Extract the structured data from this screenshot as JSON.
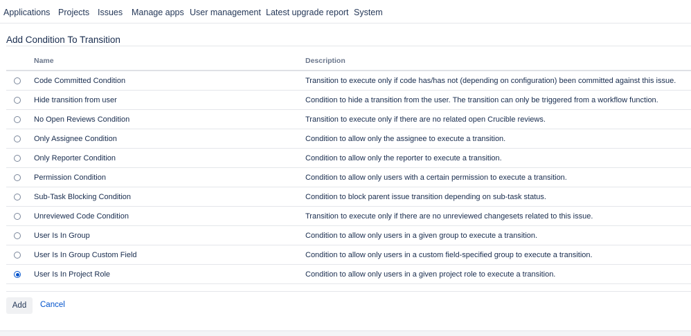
{
  "nav": {
    "items": [
      {
        "label": "Applications"
      },
      {
        "label": "Projects"
      },
      {
        "label": "Issues"
      },
      {
        "label": "Manage apps"
      },
      {
        "label": "User management"
      },
      {
        "label": "Latest upgrade report"
      },
      {
        "label": "System"
      }
    ]
  },
  "page": {
    "title": "Add Condition To Transition"
  },
  "table": {
    "columns": {
      "name": "Name",
      "description": "Description"
    },
    "rows": [
      {
        "name": "Code Committed Condition",
        "description": "Transition to execute only if code has/has not (depending on configuration) been committed against this issue.",
        "selected": false
      },
      {
        "name": "Hide transition from user",
        "description": "Condition to hide a transition from the user. The transition can only be triggered from a workflow function.",
        "selected": false
      },
      {
        "name": "No Open Reviews Condition",
        "description": "Transition to execute only if there are no related open Crucible reviews.",
        "selected": false
      },
      {
        "name": "Only Assignee Condition",
        "description": "Condition to allow only the assignee to execute a transition.",
        "selected": false
      },
      {
        "name": "Only Reporter Condition",
        "description": "Condition to allow only the reporter to execute a transition.",
        "selected": false
      },
      {
        "name": "Permission Condition",
        "description": "Condition to allow only users with a certain permission to execute a transition.",
        "selected": false
      },
      {
        "name": "Sub-Task Blocking Condition",
        "description": "Condition to block parent issue transition depending on sub-task status.",
        "selected": false
      },
      {
        "name": "Unreviewed Code Condition",
        "description": "Transition to execute only if there are no unreviewed changesets related to this issue.",
        "selected": false
      },
      {
        "name": "User Is In Group",
        "description": "Condition to allow only users in a given group to execute a transition.",
        "selected": false
      },
      {
        "name": "User Is In Group Custom Field",
        "description": "Condition to allow only users in a custom field-specified group to execute a transition.",
        "selected": false
      },
      {
        "name": "User Is In Project Role",
        "description": "Condition to allow only users in a given project role to execute a transition.",
        "selected": true
      }
    ]
  },
  "actions": {
    "add_label": "Add",
    "cancel_label": "Cancel"
  },
  "colors": {
    "link": "#0052cc",
    "text": "#172b4d",
    "header_text": "#6b778c",
    "radio_selected": "#0052cc"
  }
}
